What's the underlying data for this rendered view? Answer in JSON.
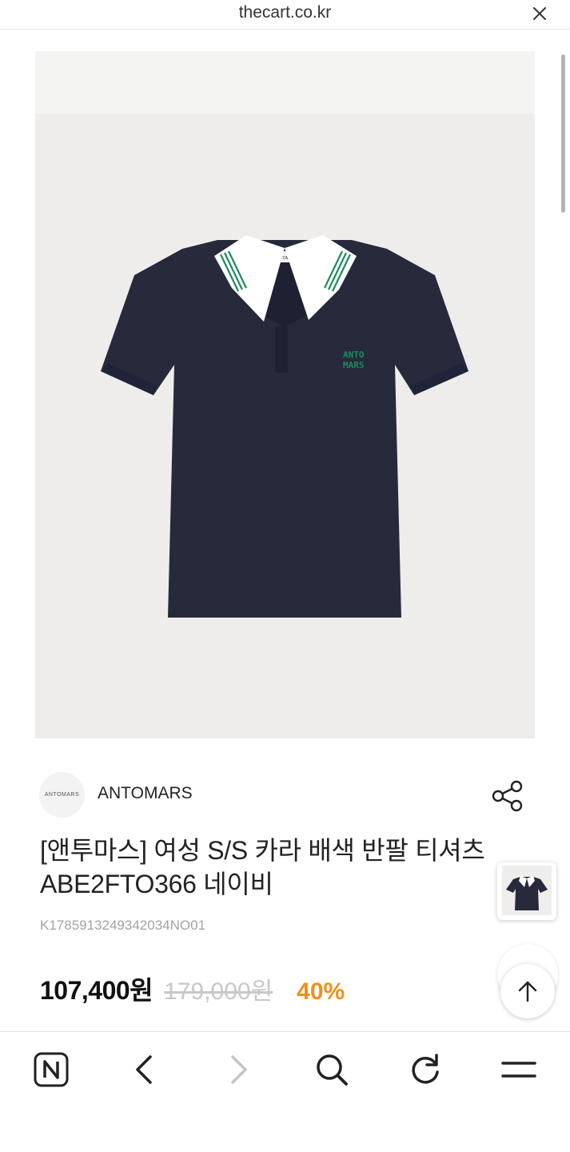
{
  "browser": {
    "url": "thecart.co.kr"
  },
  "product": {
    "shirt_logo": [
      "ANTO",
      "MARS"
    ],
    "brand_logo_text": "ANTOMARS",
    "brand_name": "ANTOMARS",
    "title": "[앤투마스] 여성 S/S 카라 배색 반팔 티셔츠 ABE2FTO366 네이비",
    "sku": "K1785913249342034NO01",
    "price": "107,400원",
    "original_price": "179,000원",
    "discount": "40%"
  },
  "colors": {
    "accent_discount": "#f0901a",
    "shirt_navy": "#262a3b",
    "collar_stripe": "#1e8a5e"
  },
  "icons": {
    "close": "close-icon",
    "share": "share-icon",
    "scroll_top": "arrow-up-icon",
    "toolbar": [
      "naver-home-icon",
      "back-icon",
      "forward-icon",
      "search-icon",
      "refresh-icon",
      "menu-icon"
    ]
  }
}
